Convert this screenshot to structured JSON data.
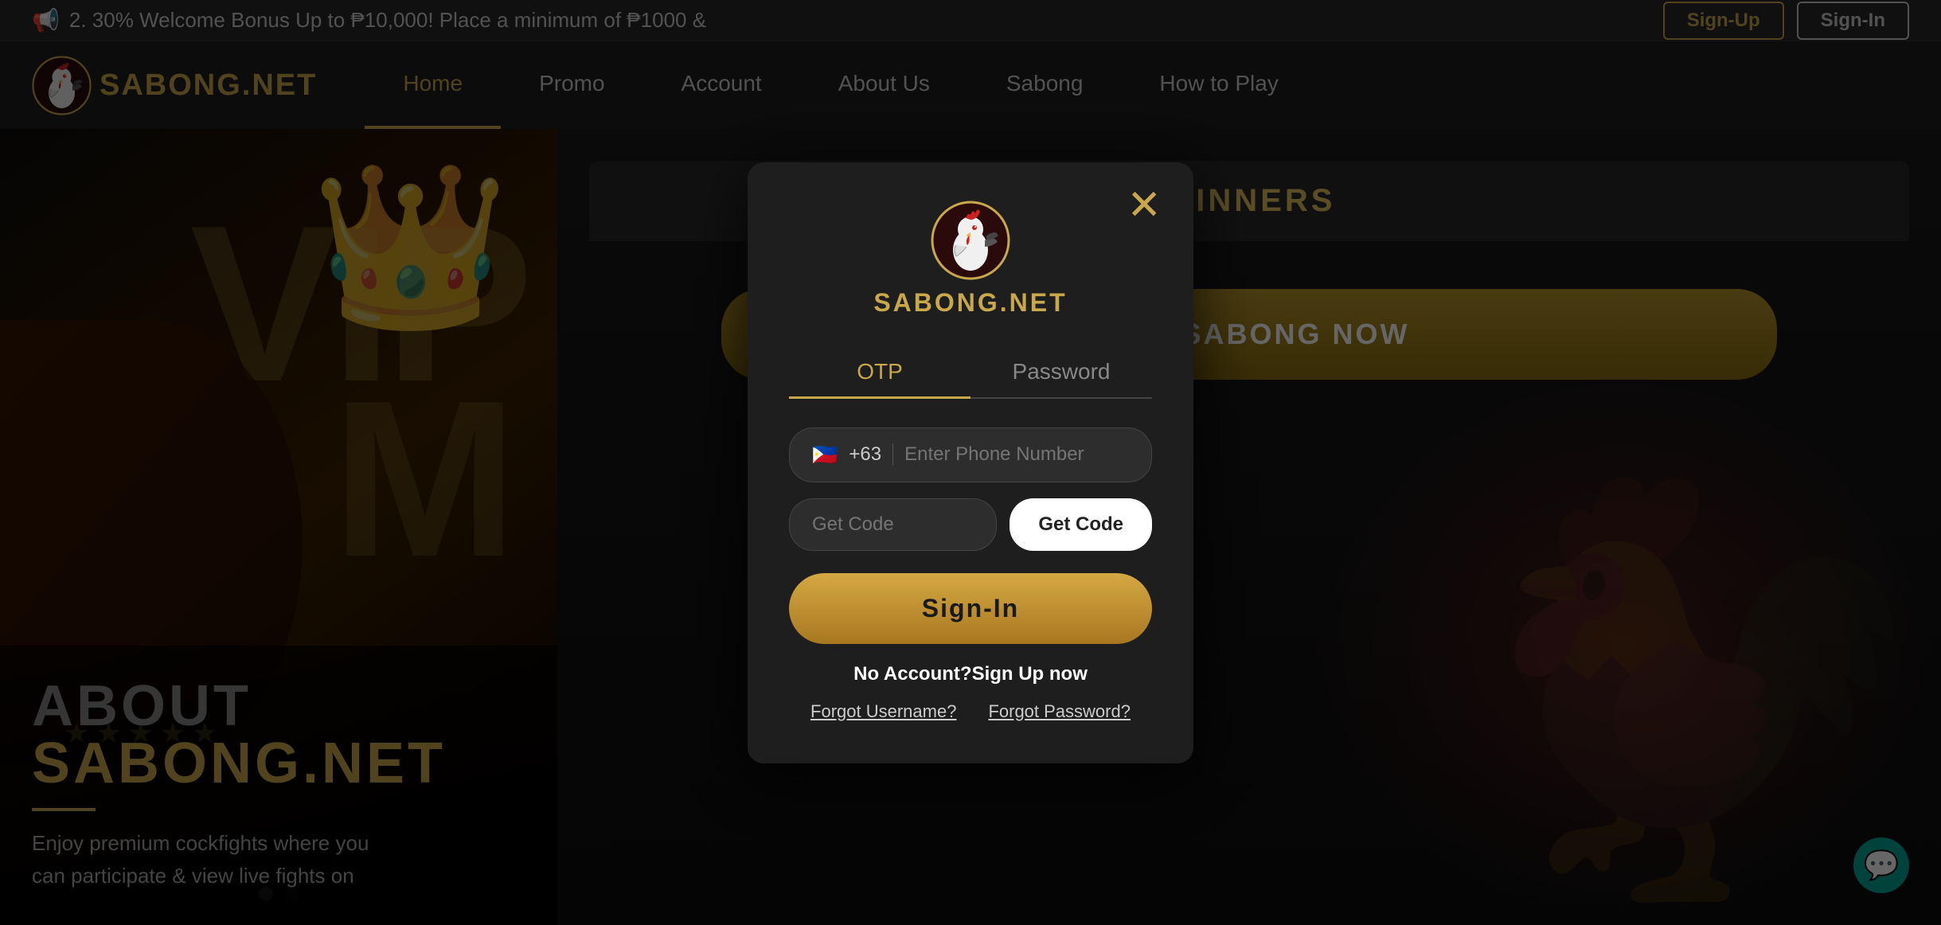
{
  "announcement": {
    "text": "2. 30% Welcome Bonus Up to ₱10,000! Place a minimum of ₱1000 &",
    "icon": "📢"
  },
  "header": {
    "logo_text": "SABONG.NET",
    "nav_items": [
      {
        "label": "Home",
        "active": true
      },
      {
        "label": "Promo",
        "active": false
      },
      {
        "label": "Account",
        "active": false
      },
      {
        "label": "About Us",
        "active": false
      },
      {
        "label": "Sabong",
        "active": false
      },
      {
        "label": "How to Play",
        "active": false
      }
    ]
  },
  "auth_buttons": {
    "signup": "Sign-Up",
    "signin": "Sign-In"
  },
  "modal": {
    "close_icon": "✕",
    "logo_text": "SABONG.NET",
    "tabs": [
      {
        "label": "OTP",
        "active": true
      },
      {
        "label": "Password",
        "active": false
      }
    ],
    "phone_flag": "🇵🇭",
    "phone_country_code": "+63",
    "phone_placeholder": "Enter Phone Number",
    "get_code_placeholder": "Get Code",
    "get_code_button": "Get Code",
    "signin_button": "Sign-In",
    "no_account_text": "No Account?",
    "signup_now": "Sign Up now",
    "forgot_username": "Forgot Username?",
    "forgot_password": "Forgot Password?"
  },
  "right_panel": {
    "winners_title": "WINNERS",
    "play_button": "PLAY SABONG NOW"
  },
  "about": {
    "title_main": "ABOUT",
    "title_brand": "SABONG.NET",
    "description": "Enjoy premium cockfights where you\ncan participate & view live fights on"
  },
  "chat": {
    "icon": "💬"
  }
}
